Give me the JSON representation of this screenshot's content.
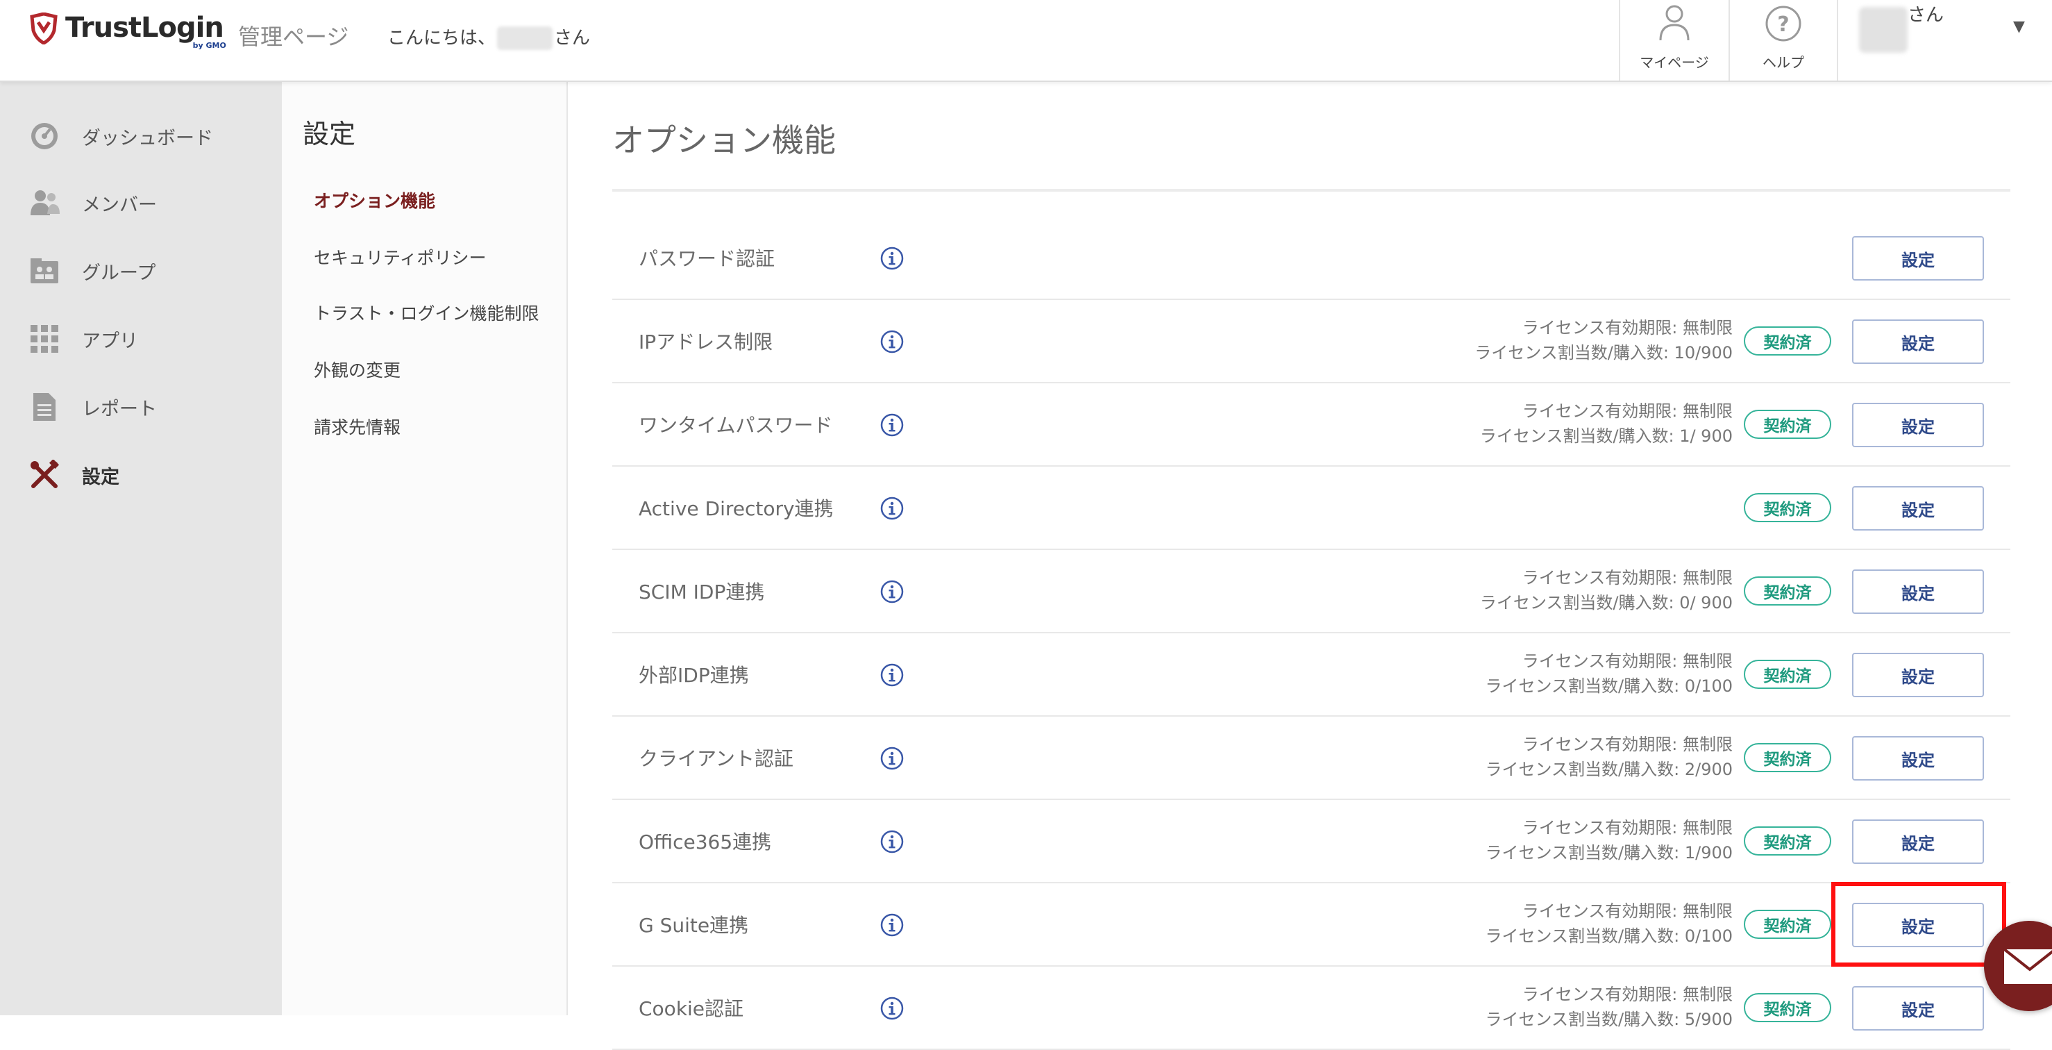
{
  "header": {
    "logo_text": "TrustLogin",
    "logo_sub": "by GMO",
    "admin_label": "管理ページ",
    "greeting_prefix": "こんにちは、",
    "greeting_suffix": "さん",
    "nav": [
      {
        "label": "マイページ",
        "icon": "person-icon"
      },
      {
        "label": "ヘルプ",
        "icon": "help-icon"
      }
    ],
    "user_suffix": "さん",
    "user_caret": "▼"
  },
  "sidebar": {
    "items": [
      {
        "label": "ダッシュボード",
        "icon": "gauge-icon"
      },
      {
        "label": "メンバー",
        "icon": "members-icon"
      },
      {
        "label": "グループ",
        "icon": "group-icon"
      },
      {
        "label": "アプリ",
        "icon": "apps-grid-icon"
      },
      {
        "label": "レポート",
        "icon": "report-icon"
      },
      {
        "label": "設定",
        "icon": "tools-icon",
        "active": true
      }
    ]
  },
  "submenu": {
    "title": "設定",
    "items": [
      {
        "label": "オプション機能",
        "active": true
      },
      {
        "label": "セキュリティポリシー"
      },
      {
        "label": "トラスト・ログイン機能制限"
      },
      {
        "label": "外観の変更"
      },
      {
        "label": "請求先情報"
      }
    ]
  },
  "main": {
    "title": "オプション機能",
    "button_label": "設定",
    "badge_label": "契約済",
    "options": [
      {
        "name": "パスワード認証",
        "license_period": "",
        "license_count": "",
        "contracted": false
      },
      {
        "name": "IPアドレス制限",
        "license_period": "ライセンス有効期限: 無制限",
        "license_count": "ライセンス割当数/購入数: 10/900",
        "contracted": true
      },
      {
        "name": "ワンタイムパスワード",
        "license_period": "ライセンス有効期限: 無制限",
        "license_count": "ライセンス割当数/購入数: 1/ 900",
        "contracted": true
      },
      {
        "name": "Active Directory連携",
        "license_period": "",
        "license_count": "",
        "contracted": true
      },
      {
        "name": "SCIM IDP連携",
        "license_period": "ライセンス有効期限: 無制限",
        "license_count": "ライセンス割当数/購入数: 0/ 900",
        "contracted": true
      },
      {
        "name": "外部IDP連携",
        "license_period": "ライセンス有効期限: 無制限",
        "license_count": "ライセンス割当数/購入数: 0/100",
        "contracted": true
      },
      {
        "name": "クライアント認証",
        "license_period": "ライセンス有効期限: 無制限",
        "license_count": "ライセンス割当数/購入数: 2/900",
        "contracted": true
      },
      {
        "name": "Office365連携",
        "license_period": "ライセンス有効期限: 無制限",
        "license_count": "ライセンス割当数/購入数: 1/900",
        "contracted": true
      },
      {
        "name": "G Suite連携",
        "license_period": "ライセンス有効期限: 無制限",
        "license_count": "ライセンス割当数/購入数: 0/100",
        "contracted": true,
        "highlighted": true
      },
      {
        "name": "Cookie認証",
        "license_period": "ライセンス有効期限: 無制限",
        "license_count": "ライセンス割当数/購入数: 5/900",
        "contracted": true
      }
    ]
  },
  "colors": {
    "brand": "#7a1f1f",
    "badge": "#36b49a",
    "button_border": "#a9b8d8",
    "highlight": "#ff1010",
    "sidebar_bg": "#e6e6e6"
  }
}
